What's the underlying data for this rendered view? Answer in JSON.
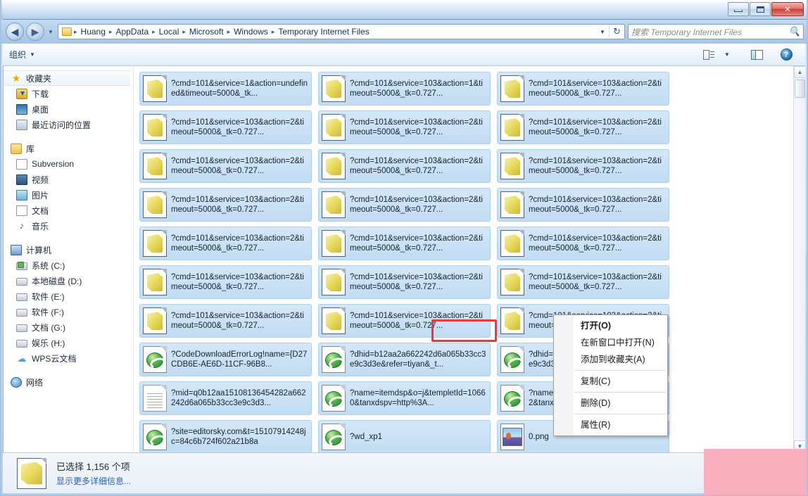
{
  "window": {
    "title": "",
    "controls": [
      {
        "name": "minimize",
        "label": "–"
      },
      {
        "name": "maximize",
        "label": "□"
      },
      {
        "name": "close",
        "label": "✕"
      }
    ]
  },
  "address_bar": {
    "back_label": "◀",
    "forward_label": "▶",
    "history_caret": "▾",
    "folder_icon": "folder-icon",
    "crumbs": [
      "Huang",
      "AppData",
      "Local",
      "Microsoft",
      "Windows",
      "Temporary Internet Files"
    ],
    "separator": "▸",
    "dropdown_caret": "▾",
    "refresh_label": "↻"
  },
  "search": {
    "placeholder": "搜索 Temporary Internet Files",
    "icon": "search-icon"
  },
  "toolbar": {
    "organize_label": "组织",
    "caret": "▾",
    "view_caret": "▾",
    "help_label": "?"
  },
  "sidebar": {
    "sections": [
      {
        "header": {
          "label": "收藏夹",
          "icon": "star-icon",
          "selected": true
        },
        "items": [
          {
            "label": "下载",
            "icon": "downloads-icon"
          },
          {
            "label": "桌面",
            "icon": "desktop-icon"
          },
          {
            "label": "最近访问的位置",
            "icon": "recent-places-icon"
          }
        ]
      },
      {
        "header": {
          "label": "库",
          "icon": "library-icon",
          "selected": false
        },
        "items": [
          {
            "label": "Subversion",
            "icon": "document-icon"
          },
          {
            "label": "视频",
            "icon": "video-icon"
          },
          {
            "label": "图片",
            "icon": "pictures-icon"
          },
          {
            "label": "文档",
            "icon": "documents-icon"
          },
          {
            "label": "音乐",
            "icon": "music-icon"
          }
        ]
      },
      {
        "header": {
          "label": "计算机",
          "icon": "computer-icon",
          "selected": false
        },
        "items": [
          {
            "label": "系统 (C:)",
            "icon": "system-drive-icon"
          },
          {
            "label": "本地磁盘 (D:)",
            "icon": "drive-icon"
          },
          {
            "label": "软件 (E:)",
            "icon": "drive-icon"
          },
          {
            "label": "软件 (F:)",
            "icon": "drive-icon"
          },
          {
            "label": "文档 (G:)",
            "icon": "drive-icon"
          },
          {
            "label": "娱乐 (H:)",
            "icon": "drive-icon"
          },
          {
            "label": "WPS云文档",
            "icon": "cloud-icon"
          }
        ]
      },
      {
        "header": {
          "label": "网络",
          "icon": "network-icon",
          "selected": false
        },
        "items": []
      }
    ]
  },
  "files": [
    {
      "name": "?cmd=101&service=1&action=undefined&timeout=5000&_tk...",
      "icon": "script-file-icon",
      "selected": true
    },
    {
      "name": "?cmd=101&service=103&action=1&timeout=5000&_tk=0.727...",
      "icon": "script-file-icon",
      "selected": true
    },
    {
      "name": "?cmd=101&service=103&action=2&timeout=5000&_tk=0.727...",
      "icon": "script-file-icon",
      "selected": true
    },
    {
      "name": "?cmd=101&service=103&action=2&timeout=5000&_tk=0.727...",
      "icon": "script-file-icon",
      "selected": true
    },
    {
      "name": "?cmd=101&service=103&action=2&timeout=5000&_tk=0.727...",
      "icon": "script-file-icon",
      "selected": true
    },
    {
      "name": "?cmd=101&service=103&action=2&timeout=5000&_tk=0.727...",
      "icon": "script-file-icon",
      "selected": true
    },
    {
      "name": "?cmd=101&service=103&action=2&timeout=5000&_tk=0.727...",
      "icon": "script-file-icon",
      "selected": true
    },
    {
      "name": "?cmd=101&service=103&action=2&timeout=5000&_tk=0.727...",
      "icon": "script-file-icon",
      "selected": true
    },
    {
      "name": "?cmd=101&service=103&action=2&timeout=5000&_tk=0.727...",
      "icon": "script-file-icon",
      "selected": true
    },
    {
      "name": "?cmd=101&service=103&action=2&timeout=5000&_tk=0.727...",
      "icon": "script-file-icon",
      "selected": true
    },
    {
      "name": "?cmd=101&service=103&action=2&timeout=5000&_tk=0.727...",
      "icon": "script-file-icon",
      "selected": true
    },
    {
      "name": "?cmd=101&service=103&action=2&timeout=5000&_tk=0.727...",
      "icon": "script-file-icon",
      "selected": true
    },
    {
      "name": "?cmd=101&service=103&action=2&timeout=5000&_tk=0.727...",
      "icon": "script-file-icon",
      "selected": true
    },
    {
      "name": "?cmd=101&service=103&action=2&timeout=5000&_tk=0.727...",
      "icon": "script-file-icon",
      "selected": true
    },
    {
      "name": "?cmd=101&service=103&action=2&timeout=5000&_tk=0.727...",
      "icon": "script-file-icon",
      "selected": true
    },
    {
      "name": "?cmd=101&service=103&action=2&timeout=5000&_tk=0.727...",
      "icon": "script-file-icon",
      "selected": true
    },
    {
      "name": "?cmd=101&service=103&action=2&timeout=5000&_tk=0.727...",
      "icon": "script-file-icon",
      "selected": true
    },
    {
      "name": "?cmd=101&service=103&action=2&timeout=5000&_tk=0.727...",
      "icon": "script-file-icon",
      "selected": true
    },
    {
      "name": "?cmd=101&service=103&action=2&timeout=5000&_tk=0.727...",
      "icon": "script-file-icon",
      "selected": true
    },
    {
      "name": "?cmd=101&service=103&action=2&timeout=5000&_tk=0.727...",
      "icon": "script-file-icon",
      "selected": true
    },
    {
      "name": "?cmd=101&service=103&action=2&timeout=5000&_tk=0.727...",
      "icon": "script-file-icon",
      "selected": true
    },
    {
      "name": "?CodeDownloadErrorLog!name={D27CDB6E-AE6D-11CF-96B8...",
      "icon": "ie-file-icon",
      "selected": true
    },
    {
      "name": "?dhid=b12aa2a662242d6a065b33cc3e9c3d3e&refer=tiyan&_t...",
      "icon": "ie-file-icon",
      "selected": true
    },
    {
      "name": "?dhid=b12aa2a662242d6a065b33cc3e9c3d3e&t=mini&source...",
      "icon": "ie-file-icon",
      "selected": true
    },
    {
      "name": "?mid=q0b12aa15108136454282a662242d6a065b33cc3e9c3d3...",
      "icon": "text-file-icon",
      "selected": true
    },
    {
      "name": "?name=itemdsp&o=j&templetId=10660&tanxdspv=http%3A...",
      "icon": "ie-file-icon",
      "selected": true
    },
    {
      "name": "?name=itemdsp&o=j&templetId=10662&tanxdspv=http%3A...",
      "icon": "ie-file-icon",
      "selected": true
    },
    {
      "name": "?site=editorsky.com&t=15107914248jc=84c6b724f602a21b8a",
      "icon": "ie-file-icon",
      "selected": true
    },
    {
      "name": "?wd_xp1",
      "icon": "ie-file-icon",
      "selected": true
    },
    {
      "name": "0.png",
      "icon": "png-file-icon",
      "selected": true
    }
  ],
  "context_menu": {
    "items": [
      {
        "label": "打开(O)",
        "bold": true,
        "separator_after": false
      },
      {
        "label": "在新窗口中打开(N)",
        "bold": false,
        "separator_after": false
      },
      {
        "label": "添加到收藏夹(A)",
        "bold": false,
        "separator_after": true
      },
      {
        "label": "复制(C)",
        "bold": false,
        "separator_after": true
      },
      {
        "label": "删除(D)",
        "bold": false,
        "separator_after": true,
        "highlighted": true
      },
      {
        "label": "属性(R)",
        "bold": false,
        "separator_after": false
      }
    ],
    "highlight_color": "#e8393c"
  },
  "status_bar": {
    "icon": "script-file-icon",
    "selection_text": "已选择 1,156 个项",
    "details_link": "显示更多详细信息..."
  },
  "scrollbar": {
    "up_arrow": "▲",
    "down_arrow": "▼"
  },
  "overlay": {
    "color": "#fbb0c0"
  }
}
